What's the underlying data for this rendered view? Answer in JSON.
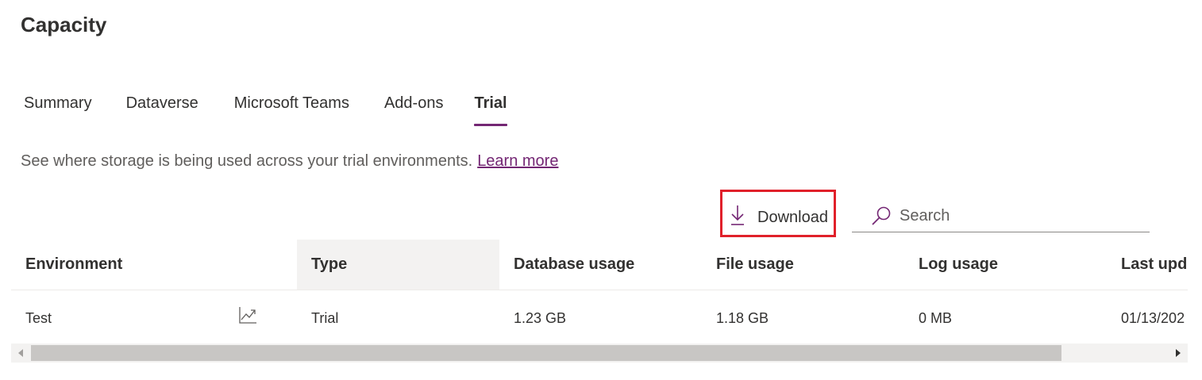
{
  "header": {
    "title": "Capacity"
  },
  "tabs": [
    {
      "label": "Summary",
      "active": false
    },
    {
      "label": "Dataverse",
      "active": false
    },
    {
      "label": "Microsoft Teams",
      "active": false
    },
    {
      "label": "Add-ons",
      "active": false
    },
    {
      "label": "Trial",
      "active": true
    }
  ],
  "description": {
    "text": "See where storage is being used across your trial environments.",
    "link_label": "Learn more"
  },
  "toolbar": {
    "download_label": "Download",
    "download_icon": "download-icon",
    "search_placeholder": "Search",
    "search_icon": "search-icon"
  },
  "table": {
    "columns": [
      "Environment",
      "Type",
      "Database usage",
      "File usage",
      "Log usage",
      "Last upda"
    ],
    "rows": [
      {
        "environment": "Test",
        "analytics_icon": "chart-line-icon",
        "type": "Trial",
        "database_usage": "1.23 GB",
        "file_usage": "1.18 GB",
        "log_usage": "0 MB",
        "last_updated": "01/13/202"
      }
    ]
  },
  "colors": {
    "accent": "#742774",
    "highlight_border": "#e0202a",
    "sorted_column_bg": "#f3f2f1"
  }
}
